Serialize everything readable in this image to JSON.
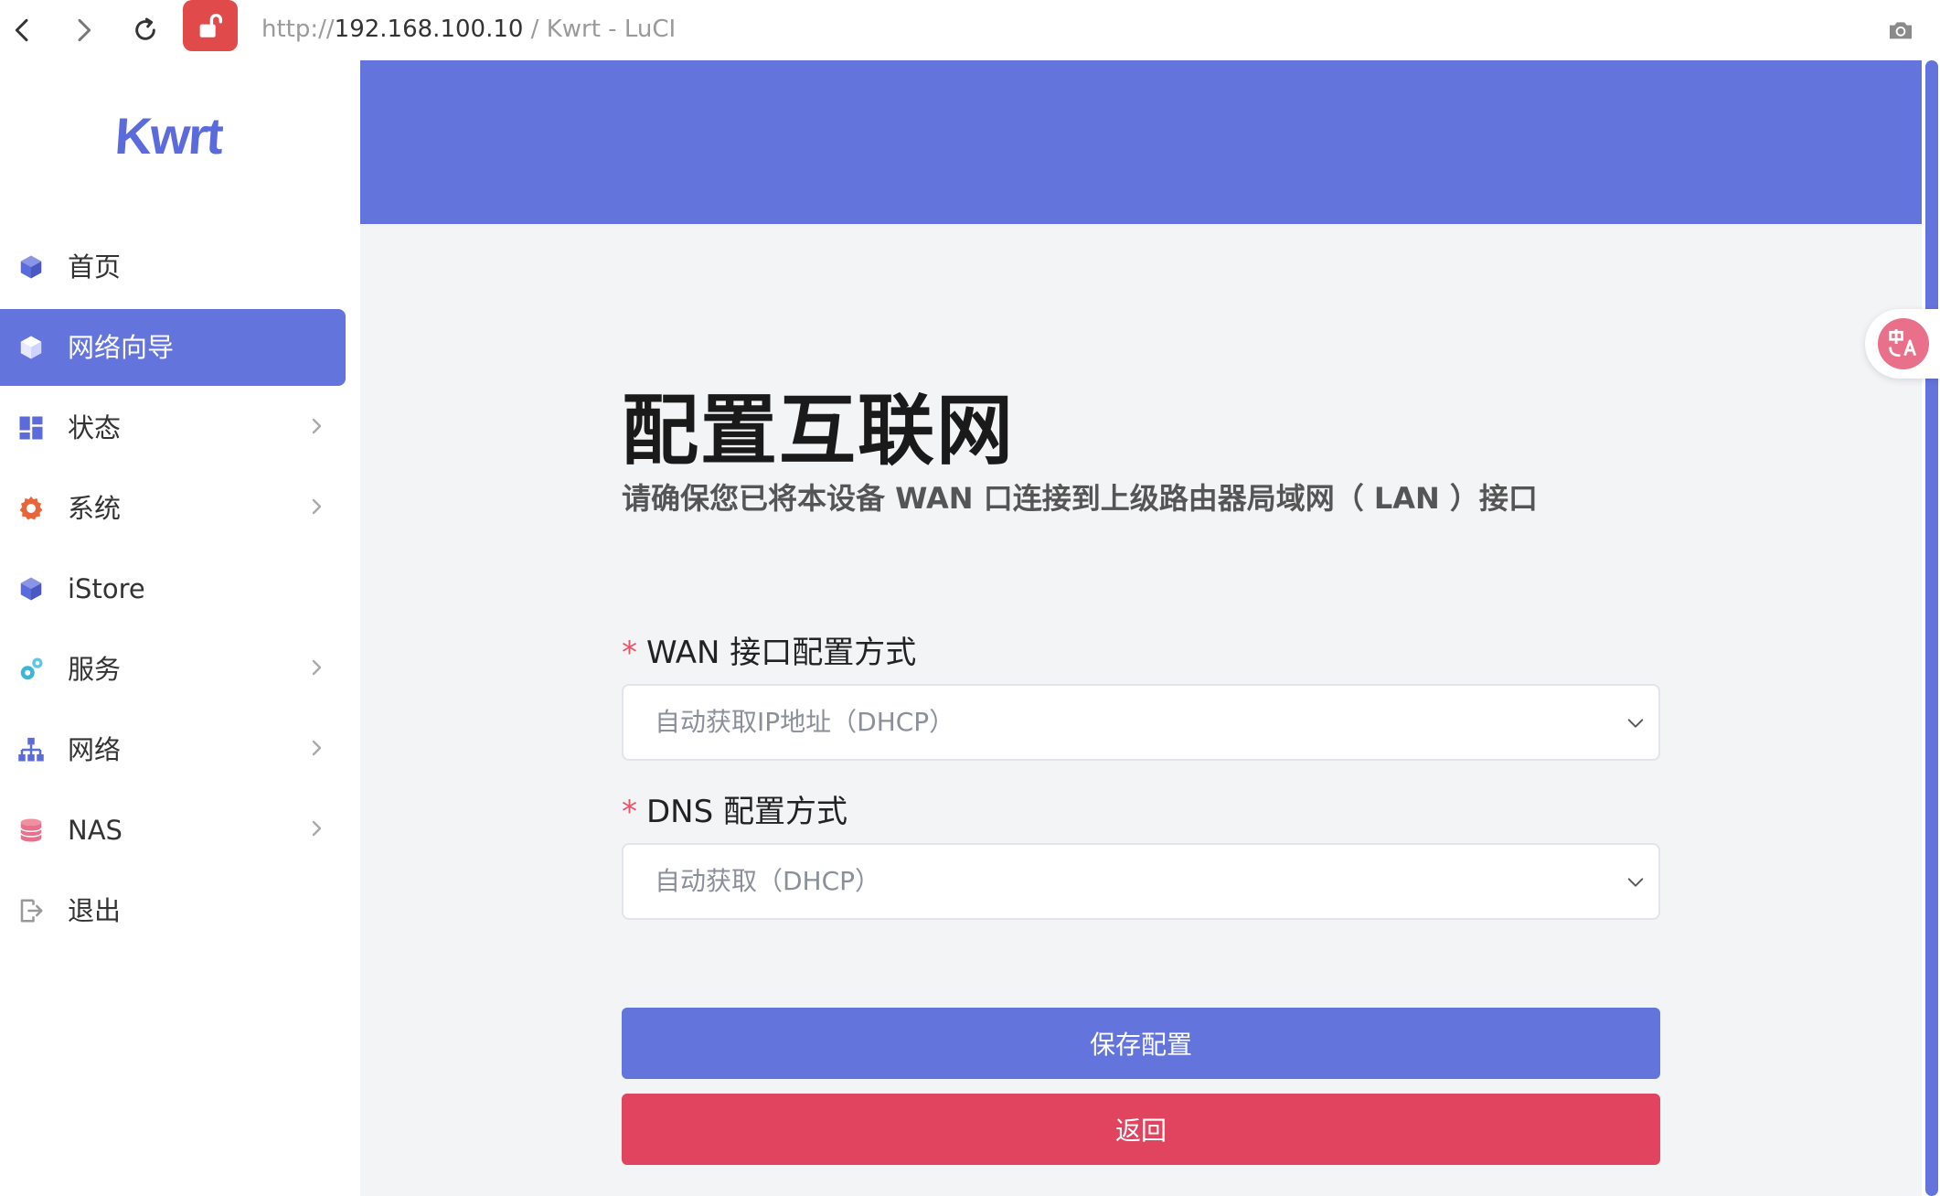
{
  "browser": {
    "url_scheme": "http://",
    "url_host": "192.168.100.10",
    "url_title": " / Kwrt - LuCI"
  },
  "sidebar": {
    "logo": "Kwrt",
    "items": [
      {
        "label": "首页",
        "icon": "cube-icon",
        "active": false,
        "has_children": false
      },
      {
        "label": "网络向导",
        "icon": "cube-icon",
        "active": true,
        "has_children": false
      },
      {
        "label": "状态",
        "icon": "dashboard-icon",
        "active": false,
        "has_children": true
      },
      {
        "label": "系统",
        "icon": "gear-icon",
        "active": false,
        "has_children": true
      },
      {
        "label": "iStore",
        "icon": "cube-icon",
        "active": false,
        "has_children": false
      },
      {
        "label": "服务",
        "icon": "gears-icon",
        "active": false,
        "has_children": true
      },
      {
        "label": "网络",
        "icon": "network-icon",
        "active": false,
        "has_children": true
      },
      {
        "label": "NAS",
        "icon": "database-icon",
        "active": false,
        "has_children": true
      },
      {
        "label": "退出",
        "icon": "logout-icon",
        "active": false,
        "has_children": false
      }
    ]
  },
  "main": {
    "title": "配置互联网",
    "subtitle": "请确保您已将本设备 WAN 口连接到上级路由器局域网（ LAN ）接口",
    "wan_field": {
      "required_mark": "*",
      "label": "WAN 接口配置方式",
      "value": "自动获取IP地址（DHCP）"
    },
    "dns_field": {
      "required_mark": "*",
      "label": "DNS 配置方式",
      "value": "自动获取（DHCP）"
    },
    "save_label": "保存配置",
    "back_label": "返回"
  },
  "colors": {
    "accent": "#6474dd",
    "danger": "#e0445e",
    "lock": "#e04a4a",
    "translate": "#e8708a"
  }
}
